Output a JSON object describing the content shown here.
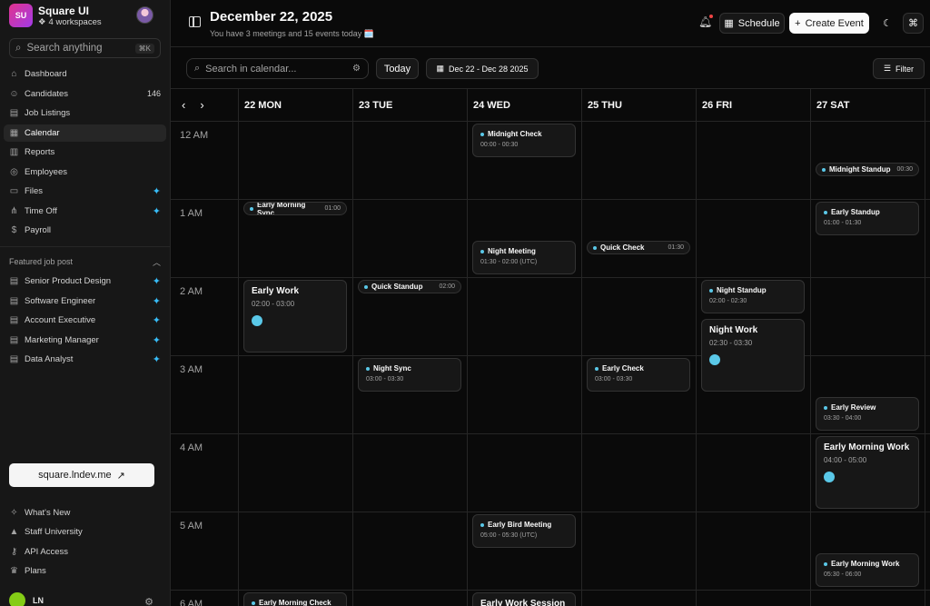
{
  "workspace": {
    "initials": "SU",
    "name": "Square UI",
    "sub": "4 workspaces"
  },
  "search": {
    "placeholder": "Search anything",
    "shortcut": "⌘K"
  },
  "nav": [
    {
      "label": "Dashboard",
      "icon": "home-icon"
    },
    {
      "label": "Candidates",
      "icon": "users-icon",
      "count": "146"
    },
    {
      "label": "Job Listings",
      "icon": "file-icon"
    },
    {
      "label": "Calendar",
      "icon": "calendar-icon",
      "active": true
    },
    {
      "label": "Reports",
      "icon": "bar-chart-icon"
    },
    {
      "label": "Employees",
      "icon": "location-icon"
    },
    {
      "label": "Files",
      "icon": "folder-icon",
      "spark": true
    },
    {
      "label": "Time Off",
      "icon": "share-icon",
      "spark": true
    },
    {
      "label": "Payroll",
      "icon": "dollar-icon"
    }
  ],
  "featured": {
    "title": "Featured job post",
    "items": [
      "Senior Product Design",
      "Software Engineer",
      "Account Executive",
      "Marketing Manager",
      "Data Analyst"
    ]
  },
  "promo": {
    "label": "square.lndev.me"
  },
  "bottom_nav": [
    {
      "label": "What's New"
    },
    {
      "label": "Staff University"
    },
    {
      "label": "API Access"
    },
    {
      "label": "Plans"
    }
  ],
  "user": {
    "initials": "LN"
  },
  "header": {
    "title": "December 22, 2025",
    "subtitle": "You have 3 meetings and 15 events today 🗓️",
    "schedule": "Schedule",
    "create": "Create Event"
  },
  "toolbar": {
    "search_placeholder": "Search in calendar...",
    "today": "Today",
    "range": "Dec 22 - Dec 28 2025",
    "filter": "Filter"
  },
  "days": [
    "22 MON",
    "23 TUE",
    "24 WED",
    "25 THU",
    "26 FRI",
    "27 SAT"
  ],
  "hours": [
    "12 AM",
    "1 AM",
    "2 AM",
    "3 AM",
    "4 AM",
    "5 AM",
    "6 AM"
  ],
  "events": [
    {
      "title": "Midnight Check",
      "time": "00:00 - 00:30"
    },
    {
      "title": "Midnight Standup",
      "time": "00:30"
    },
    {
      "title": "Early Morning Sync",
      "time": "01:00"
    },
    {
      "title": "Early Standup",
      "time": "01:00 - 01:30"
    },
    {
      "title": "Night Meeting",
      "time": "01:30 - 02:00 (UTC)"
    },
    {
      "title": "Quick Check",
      "time": "01:30"
    },
    {
      "title": "Early Work",
      "time": "02:00 - 03:00"
    },
    {
      "title": "Quick Standup",
      "time": "02:00"
    },
    {
      "title": "Night Standup",
      "time": "02:00 - 02:30"
    },
    {
      "title": "Night Work",
      "time": "02:30 - 03:30"
    },
    {
      "title": "Night Sync",
      "time": "03:00 - 03:30"
    },
    {
      "title": "Early Check",
      "time": "03:00 - 03:30"
    },
    {
      "title": "Early Review",
      "time": "03:30 - 04:00"
    },
    {
      "title": "Early Morning Work",
      "time": "04:00 - 05:00"
    },
    {
      "title": "Early Bird Meeting",
      "time": "05:00 - 05:30 (UTC)"
    },
    {
      "title": "Early Morning Work",
      "time": "05:30 - 06:00"
    },
    {
      "title": "Early Morning Check",
      "time": ""
    },
    {
      "title": "Early Work Session",
      "time": ""
    }
  ]
}
